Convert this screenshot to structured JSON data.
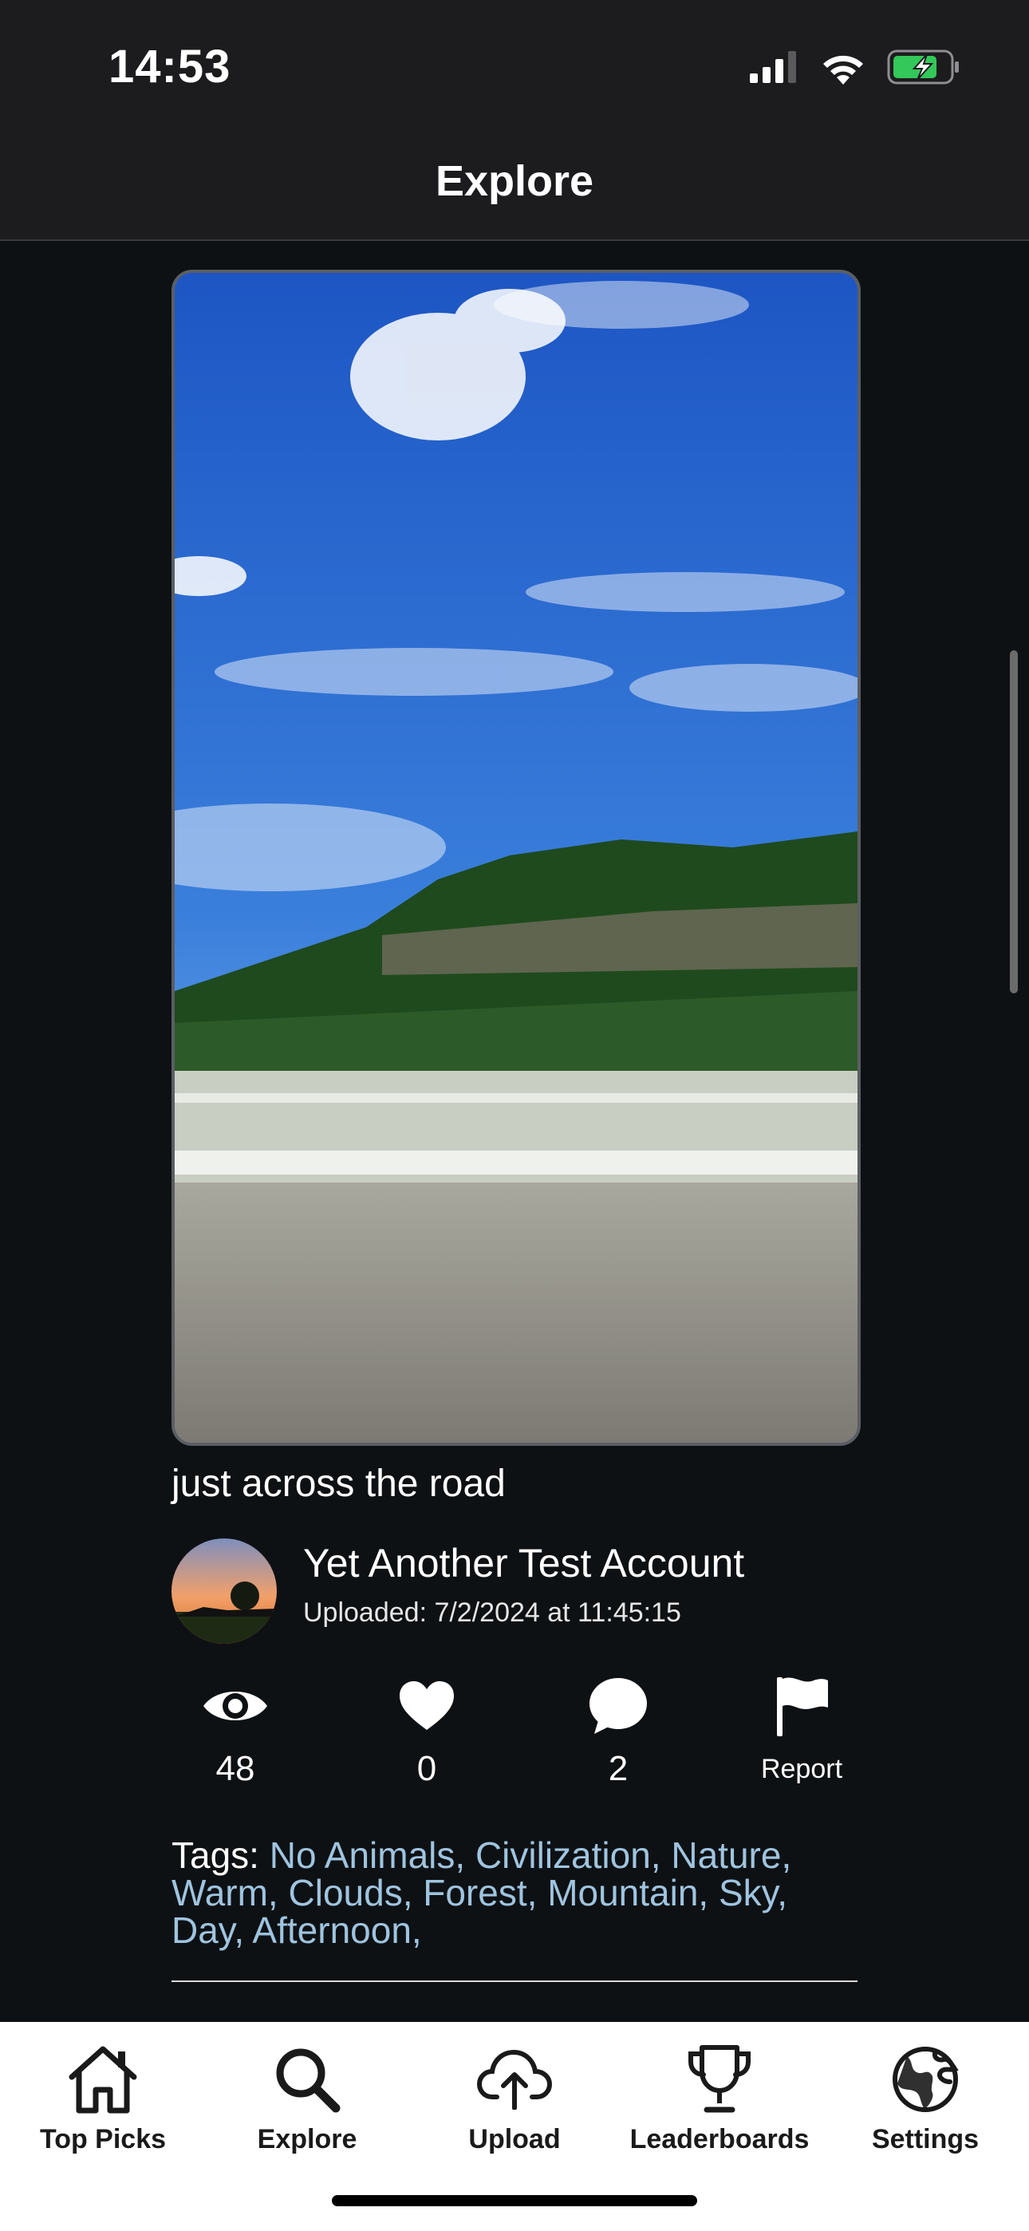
{
  "status_bar": {
    "time": "14:53"
  },
  "header": {
    "title": "Explore"
  },
  "post": {
    "caption": "just across the road",
    "author": "Yet Another Test Account",
    "uploaded": "Uploaded: 7/2/2024 at 11:45:15",
    "stats": {
      "views": "48",
      "likes": "0",
      "comments": "2",
      "report_label": "Report"
    },
    "tags_label": "Tags:",
    "tags": [
      "No Animals,",
      "Civilization,",
      "Nature,",
      "Warm,",
      "Clouds,",
      "Forest,",
      "Mountain,",
      "Sky,",
      "Day,",
      "Afternoon,"
    ]
  },
  "tab_bar": {
    "items": [
      {
        "label": "Top Picks",
        "icon": "home-icon"
      },
      {
        "label": "Explore",
        "icon": "search-icon"
      },
      {
        "label": "Upload",
        "icon": "cloud-upload-icon"
      },
      {
        "label": "Leaderboards",
        "icon": "trophy-icon"
      },
      {
        "label": "Settings",
        "icon": "globe-icon"
      }
    ]
  },
  "colors": {
    "background": "#0e1114",
    "bar": "#1c1c1e",
    "tag": "#9fc4df",
    "battery": "#34c759"
  }
}
